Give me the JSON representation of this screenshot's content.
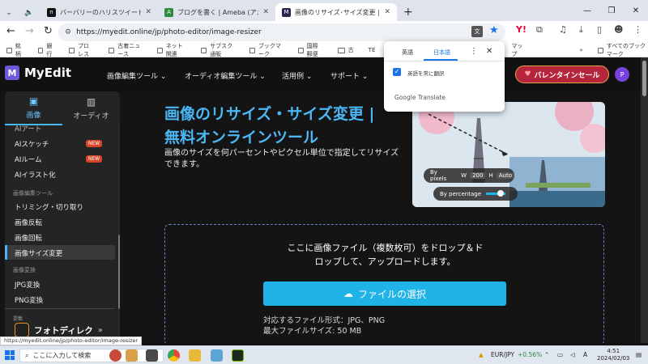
{
  "browser": {
    "tabs": [
      {
        "title": "バーバリーのハリスツイードジャケットをレスキ…",
        "active": false
      },
      {
        "title": "ブログを書く | Ameba (アメーバ)",
        "active": false
      },
      {
        "title": "画像のリサイズ･サイズ変更 | 無料オンライ…",
        "active": true
      }
    ],
    "new_tab": "+",
    "url": "https://myedit.online/jp/photo-editor/image-resizer",
    "bookmarks": [
      "銘柄",
      "銀行",
      "プロレス",
      "古着ニュース",
      "ネット関連",
      "サブスク通販",
      "ブックマーク",
      "国際郵便",
      "古",
      "TE"
    ],
    "bookmarks_trailing": "マップ",
    "all_bookmarks": "すべてのブックマーク"
  },
  "translate_popup": {
    "tab_english": "英語",
    "tab_japanese": "日本語",
    "checkbox_label": "英語を常に翻訳",
    "footer": "Google Translate",
    "footer_g": "Google"
  },
  "site": {
    "brand": "MyEdit",
    "nav": [
      "画像編集ツール",
      "オーディオ編集ツール",
      "活用例",
      "サポート"
    ],
    "promo": "バレンタインセール",
    "avatar": "P"
  },
  "sidebar": {
    "tab_image": "画像",
    "tab_audio": "オーディオ",
    "items_top": [
      {
        "label": "AIアート",
        "badge": ""
      },
      {
        "label": "AIスケッチ",
        "badge": "NEW"
      },
      {
        "label": "AIルーム",
        "badge": "NEW"
      },
      {
        "label": "AIイラスト化",
        "badge": ""
      }
    ],
    "section_edit": "画像編集ツール",
    "items_edit": [
      "トリミング・切り取り",
      "画像反転",
      "画像回転",
      "画像サイズ変更"
    ],
    "section_convert": "画像変換",
    "items_convert": [
      "JPG変換",
      "PNG変換"
    ],
    "section_recommend": "提載",
    "promo_app": "フォトディレク"
  },
  "main": {
    "title_line1": "画像のリサイズ・サイズ変更 |",
    "title_line2": "無料オンラインツール",
    "description": "画像のサイズを何パーセントやピクセル単位で指定してリサイズできます。",
    "hero": {
      "by_pixels": "By pixels",
      "w_label": "W",
      "w_value": "200",
      "h_label": "H",
      "h_value": "Auto",
      "by_percentage": "By percentage"
    },
    "drop_line1": "ここに画像ファイル（複数枚可）をドロップ＆ド",
    "drop_line2": "ロップして、アップロードします。",
    "select_button": "ファイルの選択",
    "formats": "対応するファイル形式：JPG、PNG",
    "max_size": "最大ファイルサイズ: 50 MB"
  },
  "status_url": "https://myedit.online/jp/photo-editor/image-resizer",
  "taskbar": {
    "search_placeholder": "ここに入力して検索",
    "ticker": "EUR/JPY",
    "ticker_change": "+0.56%",
    "time": "4:51",
    "date": "2024/02/03"
  },
  "colors": {
    "accent_blue": "#1fb3e8",
    "title_blue": "#4cb7f5",
    "brand_purple": "#6b5bd9",
    "new_badge": "#d9452b",
    "ticker_green": "#2e8b3a"
  }
}
